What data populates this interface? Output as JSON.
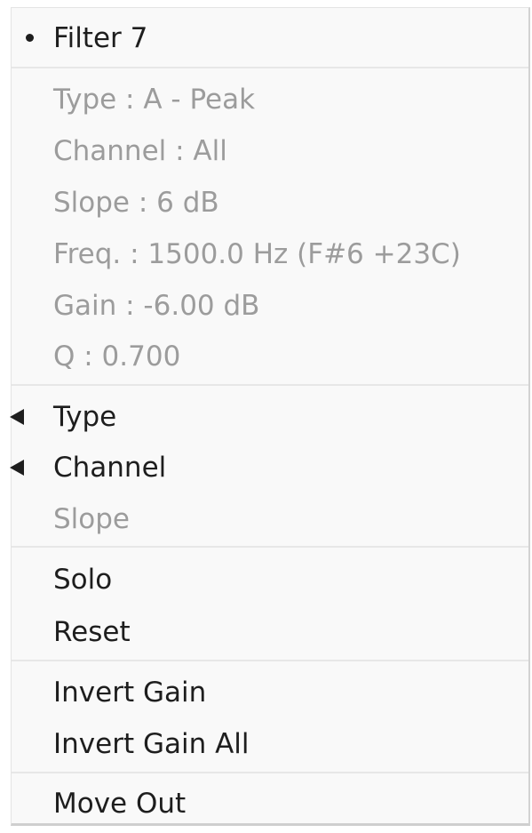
{
  "menu": {
    "header": {
      "label": "Filter 7"
    },
    "info": {
      "type": "Type : A - Peak",
      "channel": "Channel : All",
      "slope": "Slope :  6 dB",
      "freq": "Freq. : 1500.0 Hz (F#6 +23C)",
      "gain": "Gain : -6.00 dB",
      "q": "Q : 0.700"
    },
    "submenus": {
      "type": "Type",
      "channel": "Channel",
      "slope": "Slope"
    },
    "actions": {
      "solo": "Solo",
      "reset": "Reset",
      "invert_gain": "Invert Gain",
      "invert_gain_all": "Invert Gain All",
      "move_out": "Move Out"
    }
  }
}
